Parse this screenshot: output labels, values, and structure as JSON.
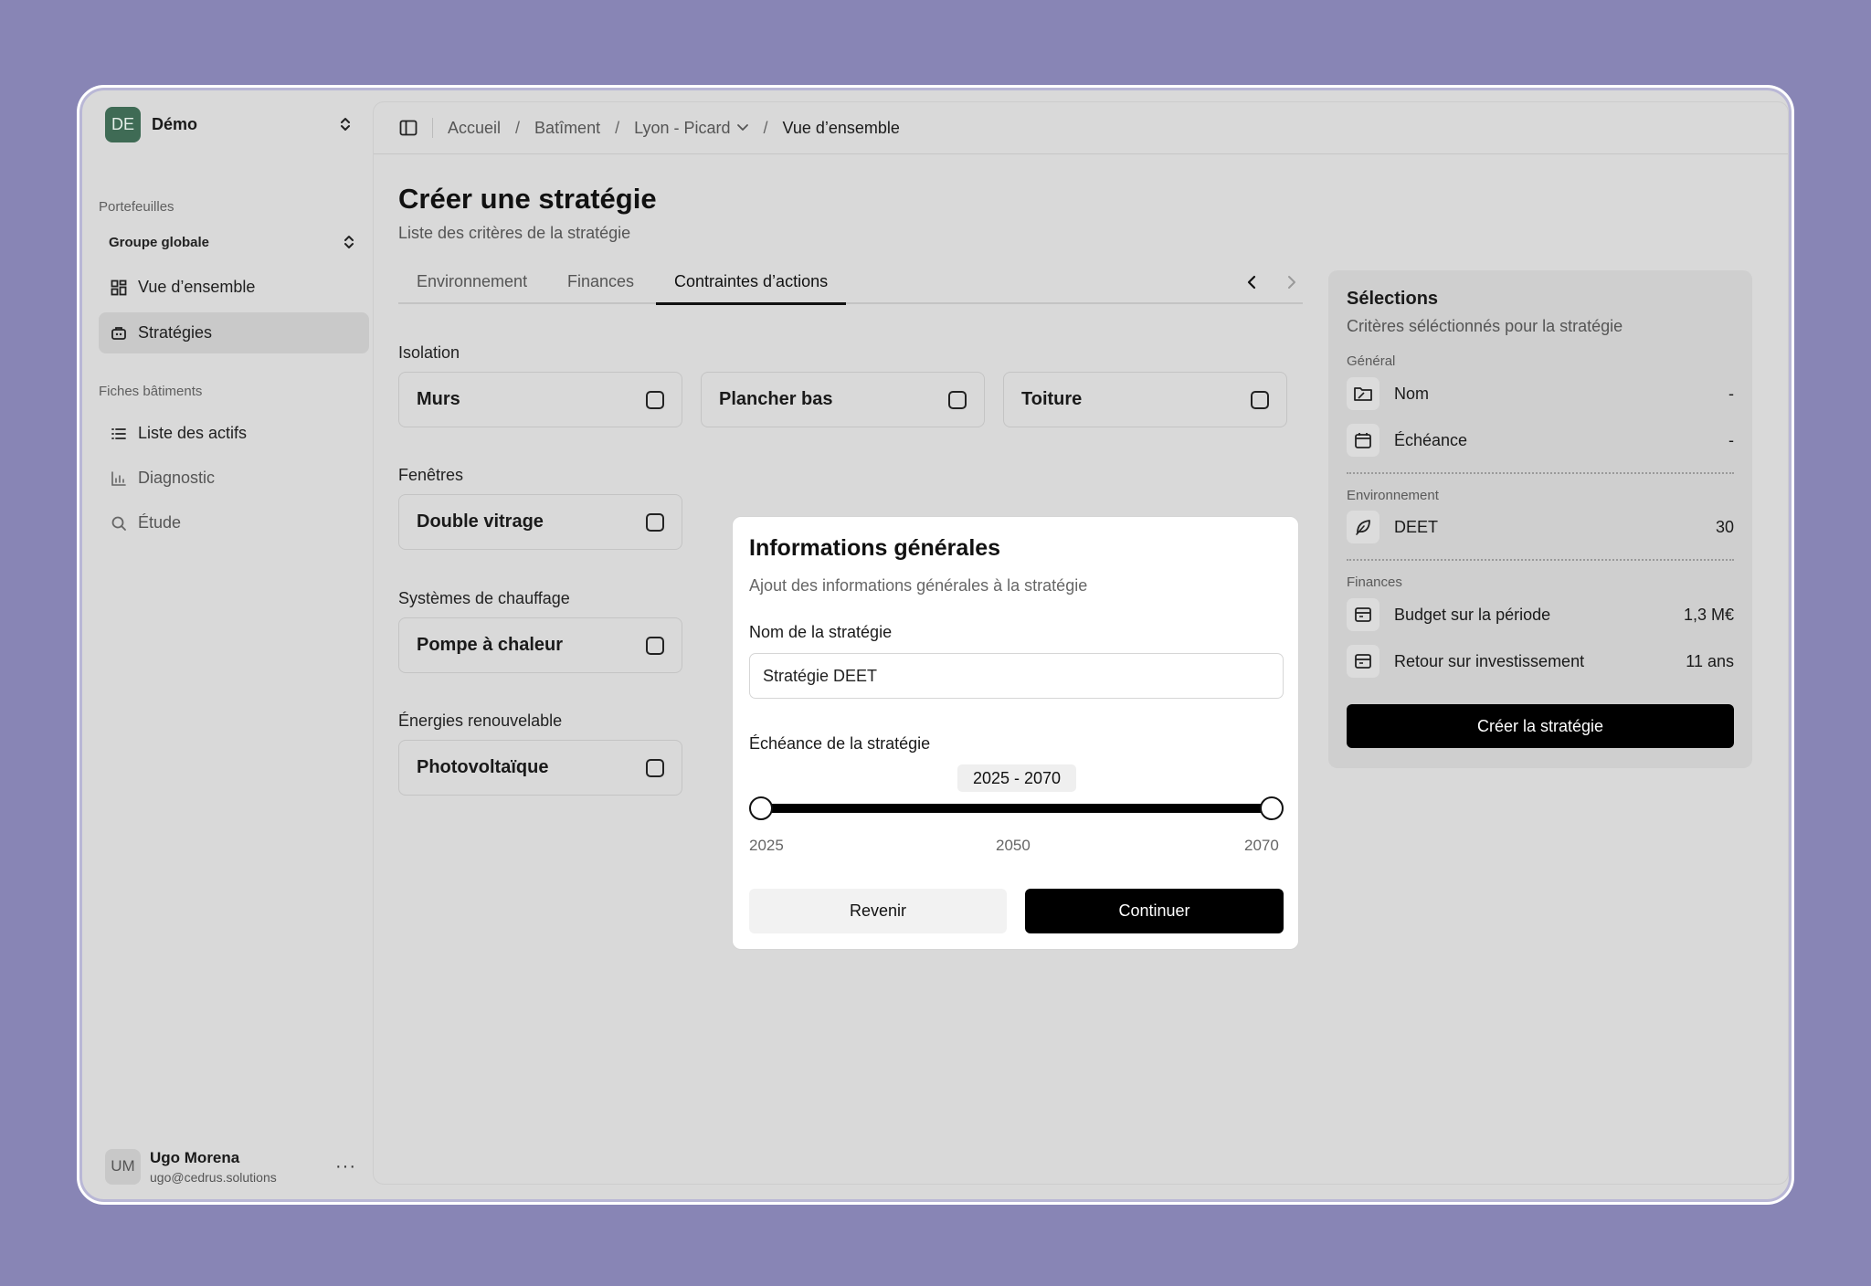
{
  "workspace": {
    "initials": "DE",
    "name": "Démo"
  },
  "sidebar": {
    "portfolios_label": "Portefeuilles",
    "group": "Groupe globale",
    "portfolio_items": [
      {
        "label": "Vue d’ensemble",
        "icon": "grid-icon"
      },
      {
        "label": "Stratégies",
        "icon": "strategy-icon"
      }
    ],
    "buildings_label": "Fiches bâtiments",
    "building_items": [
      {
        "label": "Liste des actifs",
        "icon": "list-icon"
      },
      {
        "label": "Diagnostic",
        "icon": "bar-chart-icon"
      },
      {
        "label": "Étude",
        "icon": "search-icon"
      }
    ]
  },
  "user": {
    "initials": "UM",
    "name": "Ugo Morena",
    "email": "ugo@cedrus.solutions",
    "more": "···"
  },
  "breadcrumb": [
    "Accueil",
    "Batîment",
    "Lyon - Picard",
    "Vue d’ensemble"
  ],
  "page": {
    "title": "Créer une stratégie",
    "subtitle": "Liste des critères de la stratégie"
  },
  "tabs": [
    "Environnement",
    "Finances",
    "Contraintes d’actions"
  ],
  "active_tab": "Contraintes d’actions",
  "categories": [
    {
      "label": "Isolation",
      "items": [
        "Murs",
        "Plancher bas",
        "Toiture"
      ]
    },
    {
      "label": "Fenêtres",
      "items": [
        "Double vitrage"
      ]
    },
    {
      "label": "Systèmes de chauffage",
      "items": [
        "Pompe à chaleur"
      ]
    },
    {
      "label": "Énergies renouvelable",
      "items": [
        "Photovoltaïque"
      ]
    }
  ],
  "summary": {
    "title": "Sélections",
    "subtitle": "Critères séléctionnés pour la stratégie",
    "groups": {
      "general": {
        "label": "Général",
        "rows": [
          {
            "label": "Nom",
            "value": "-"
          },
          {
            "label": "Échéance",
            "value": "-"
          }
        ]
      },
      "environment": {
        "label": "Environnement",
        "rows": [
          {
            "label": "DEET",
            "value": "30"
          }
        ]
      },
      "finances": {
        "label": "Finances",
        "rows": [
          {
            "label": "Budget sur la période",
            "value": "1,3 M€"
          },
          {
            "label": "Retour sur investissement",
            "value": "11 ans"
          }
        ]
      }
    },
    "create_label": "Créer la stratégie"
  },
  "modal": {
    "title": "Informations générales",
    "subtitle": "Ajout des informations générales à la stratégie",
    "name_label": "Nom de la stratégie",
    "name_value": "Stratégie DEET",
    "deadline_label": "Échéance de la stratégie",
    "range_display": "2025 - 2070",
    "range": {
      "min": 2025,
      "max": 2070,
      "start": 2025,
      "end": 2070
    },
    "ticks": [
      "2025",
      "2050",
      "2070"
    ],
    "back_label": "Revenir",
    "continue_label": "Continuer"
  },
  "colors": {
    "background": "#8885b5",
    "logo": "#3f6b55",
    "primary": "#000000"
  }
}
